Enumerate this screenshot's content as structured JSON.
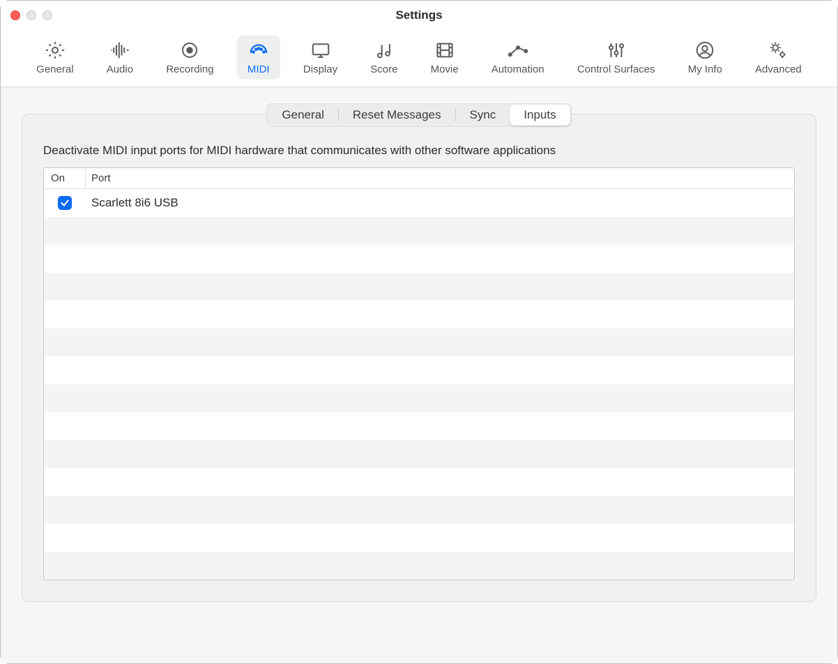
{
  "window": {
    "title": "Settings"
  },
  "toolbar": {
    "items": [
      {
        "id": "general",
        "label": "General"
      },
      {
        "id": "audio",
        "label": "Audio"
      },
      {
        "id": "recording",
        "label": "Recording"
      },
      {
        "id": "midi",
        "label": "MIDI"
      },
      {
        "id": "display",
        "label": "Display"
      },
      {
        "id": "score",
        "label": "Score"
      },
      {
        "id": "movie",
        "label": "Movie"
      },
      {
        "id": "automation",
        "label": "Automation"
      },
      {
        "id": "control-surfaces",
        "label": "Control Surfaces"
      },
      {
        "id": "my-info",
        "label": "My Info"
      },
      {
        "id": "advanced",
        "label": "Advanced"
      }
    ],
    "selected": "midi"
  },
  "midi": {
    "subtabs": [
      "General",
      "Reset Messages",
      "Sync",
      "Inputs"
    ],
    "selected_subtab": "Inputs",
    "inputs": {
      "description": "Deactivate MIDI input ports for MIDI hardware that communicates with other software applications",
      "columns": {
        "on": "On",
        "port": "Port"
      },
      "rows": [
        {
          "on": true,
          "port": "Scarlett 8i6 USB"
        }
      ],
      "empty_row_count": 14
    }
  },
  "colors": {
    "accent": "#0b6af4"
  }
}
